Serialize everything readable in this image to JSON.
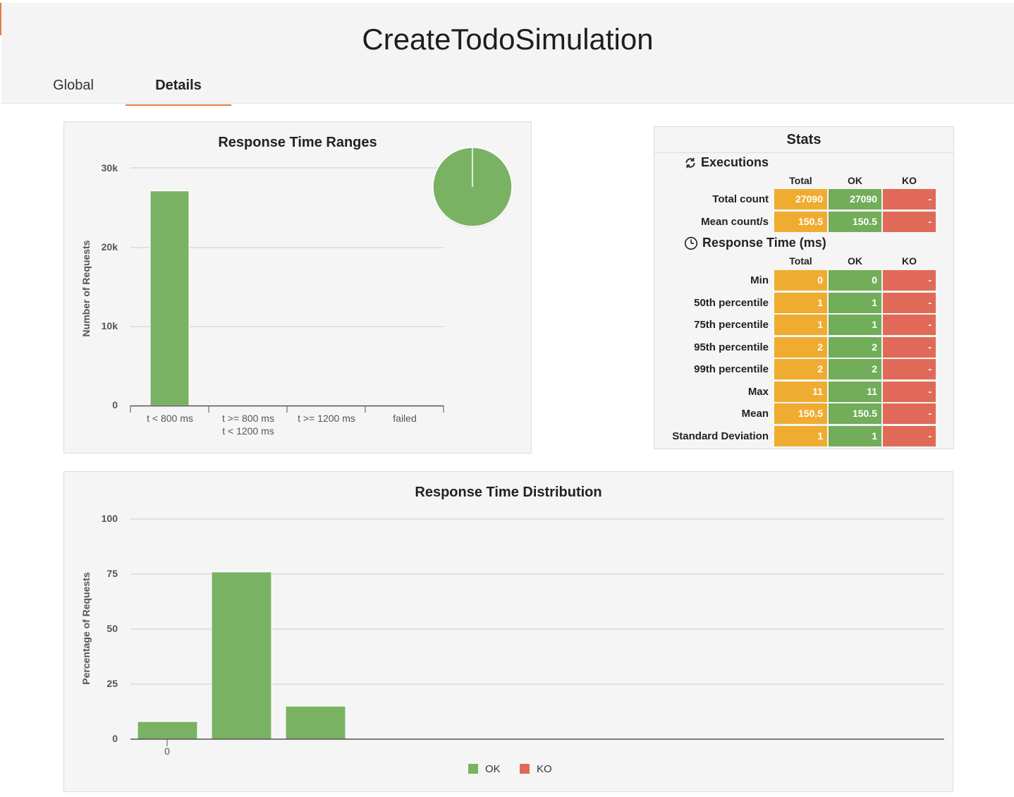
{
  "page": {
    "title": "CreateTodoSimulation"
  },
  "tabs": [
    {
      "label": "Global"
    },
    {
      "label": "Details"
    }
  ],
  "colors": {
    "ok": "#7ab263",
    "ko": "#e06a57",
    "total": "#f0ac30",
    "accent": "#e37c47"
  },
  "range_chart": {
    "chart_data": {
      "type": "bar",
      "title": "Response Time Ranges",
      "ylabel": "Number of Requests",
      "xlabel": "",
      "categories": [
        "t < 800 ms",
        "t >= 800 ms\nt < 1200 ms",
        "t >= 1200 ms",
        "failed"
      ],
      "values": [
        27090,
        0,
        0,
        0
      ],
      "ylim": [
        0,
        30000
      ],
      "yticks": [
        "0",
        "10k",
        "20k",
        "30k"
      ],
      "grid": true
    },
    "pie": {
      "slices": [
        27090,
        0,
        0,
        0
      ]
    }
  },
  "stats": {
    "title": "Stats",
    "executions": {
      "title": "Executions",
      "headers": [
        "Total",
        "OK",
        "KO"
      ],
      "rows": [
        {
          "label": "Total count",
          "total": "27090",
          "ok": "27090",
          "ko": "-"
        },
        {
          "label": "Mean count/s",
          "total": "150.5",
          "ok": "150.5",
          "ko": "-"
        }
      ]
    },
    "response_time": {
      "title": "Response Time (ms)",
      "headers": [
        "Total",
        "OK",
        "KO"
      ],
      "rows": [
        {
          "label": "Min",
          "total": "0",
          "ok": "0",
          "ko": "-"
        },
        {
          "label": "50th percentile",
          "total": "1",
          "ok": "1",
          "ko": "-"
        },
        {
          "label": "75th percentile",
          "total": "1",
          "ok": "1",
          "ko": "-"
        },
        {
          "label": "95th percentile",
          "total": "2",
          "ok": "2",
          "ko": "-"
        },
        {
          "label": "99th percentile",
          "total": "2",
          "ok": "2",
          "ko": "-"
        },
        {
          "label": "Max",
          "total": "11",
          "ok": "11",
          "ko": "-"
        },
        {
          "label": "Mean",
          "total": "150.5",
          "ok": "150.5",
          "ko": "-"
        },
        {
          "label": "Standard Deviation",
          "total": "1",
          "ok": "1",
          "ko": "-"
        }
      ]
    }
  },
  "distribution_chart": {
    "chart_data": {
      "type": "bar",
      "title": "Response Time Distribution",
      "ylabel": "Percentage of Requests",
      "xlabel": "",
      "x": [
        0,
        1,
        2,
        3
      ],
      "xticks": [
        "0"
      ],
      "series": [
        {
          "name": "OK",
          "values": [
            8,
            76,
            15,
            0
          ]
        },
        {
          "name": "KO",
          "values": [
            0,
            0,
            0,
            0
          ]
        }
      ],
      "ylim": [
        0,
        100
      ],
      "yticks": [
        "0",
        "25",
        "50",
        "75",
        "100"
      ],
      "grid": true,
      "legend": "bottom-center"
    }
  }
}
